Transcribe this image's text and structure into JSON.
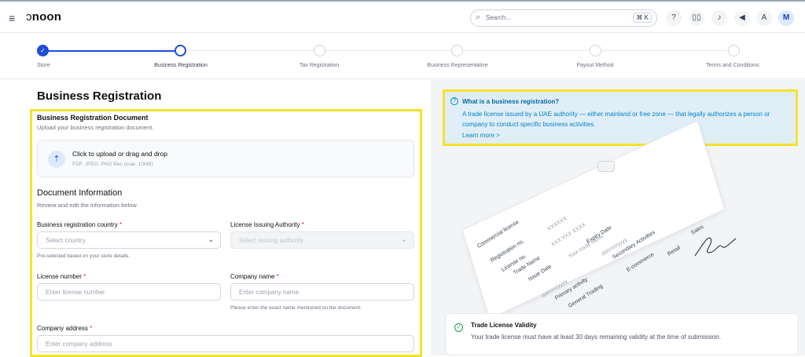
{
  "topbar": {
    "menu_icon": "≡",
    "brand": "noon",
    "search_placeholder": "Search...",
    "search_shortcut": "⌘ K",
    "icons": [
      "help-icon",
      "book-icon",
      "bell-icon",
      "megaphone-icon",
      "translate-icon"
    ],
    "avatar_initial": "M"
  },
  "stepper": {
    "steps": [
      {
        "label": "Store",
        "state": "done"
      },
      {
        "label": "Business Registration",
        "state": "current"
      },
      {
        "label": "Tax Registration",
        "state": "todo"
      },
      {
        "label": "Business Representative",
        "state": "todo"
      },
      {
        "label": "Payout Method",
        "state": "todo"
      },
      {
        "label": "Terms and Conditions",
        "state": "todo"
      }
    ]
  },
  "page": {
    "title": "Business Registration"
  },
  "registration_doc": {
    "title": "Business Registration Document",
    "subtitle": "Upload your business registration document.",
    "upload_title": "Click to upload or drag and drop",
    "upload_hint": "PDF, JPEG, PNG files (max. 10MB)"
  },
  "doc_info": {
    "title": "Document Information",
    "subtitle": "Review and edit the information below",
    "country": {
      "label": "Business registration country",
      "required": "*",
      "placeholder": "Select country",
      "hint": "Pre-selected based on your store details."
    },
    "authority": {
      "label": "License Issuing Authority",
      "required": "*",
      "placeholder": "Select issuing authority"
    },
    "license": {
      "label": "License number",
      "required": "*",
      "placeholder": "Enter license number"
    },
    "company": {
      "label": "Company name",
      "required": "*",
      "placeholder": "Enter company name",
      "hint": "Please enter the exact name mentioned on the document."
    },
    "address": {
      "label": "Company address",
      "required": "*",
      "placeholder": "Enter company address"
    }
  },
  "info_box": {
    "title": "What is a business registration?",
    "description": "A trade license issued by a UAE authority — either mainland or free zone — that legally authorizes a person or company to conduct specific business activities.",
    "link": "Learn more >"
  },
  "sample_doc": {
    "labels": [
      "Commercial license",
      "Registration no.",
      "License no.",
      "Trade Name",
      "Issue Date",
      "Primary activity",
      "General Trading",
      "Expiry Date",
      "Secondary Activities",
      "E-commerce",
      "Retail",
      "Sales"
    ],
    "values": [
      "XXXXXX",
      "XXX XXX XXXX",
      "Your trade name",
      "dd/mm/yyyy",
      "dd/mm/yyyy"
    ]
  },
  "validity": {
    "title": "Trade License Validity",
    "description": "Your trade license must have at least 30 days remaining validity at the time of submission."
  },
  "colors": {
    "accent": "#1d4ed8",
    "highlight": "#f5e22c",
    "info_bg": "#e0eef7",
    "info_text": "#0284c7"
  }
}
